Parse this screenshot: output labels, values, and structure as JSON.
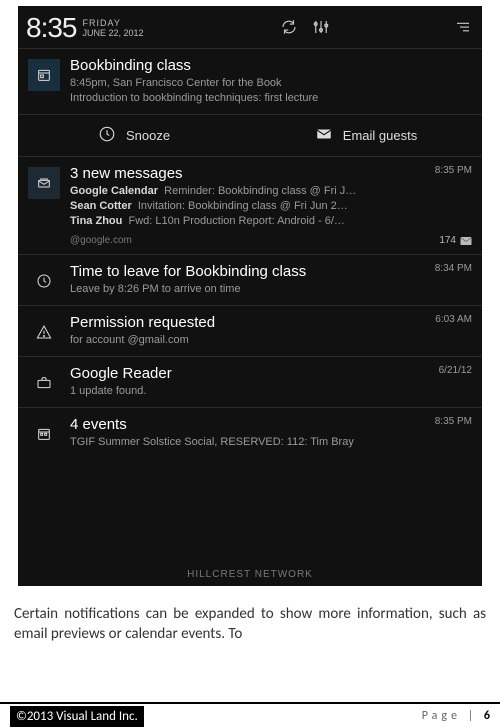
{
  "statusbar": {
    "time": "8:35",
    "day": "FRIDAY",
    "date": "JUNE 22, 2012"
  },
  "notifications": [
    {
      "icon": "calendar-day-icon",
      "title": "Bookbinding class",
      "sub1": "8:45pm, San Francisco Center for the Book",
      "sub2": "Introduction to bookbinding techniques: first lecture"
    },
    {
      "icon": "mail-stack-icon",
      "title": "3 new messages",
      "timestamp": "8:35 PM",
      "lines": [
        {
          "sender": "Google Calendar",
          "text": "Reminder: Bookbinding class @ Fri J…"
        },
        {
          "sender": "Sean Cotter",
          "text": "Invitation: Bookbinding class @ Fri Jun 2…"
        },
        {
          "sender": "Tina Zhou",
          "text": "Fwd: L10n Production Report: Android - 6/…"
        }
      ],
      "account": "@google.com",
      "count": "174"
    },
    {
      "icon": "clock-icon",
      "title": "Time to leave for Bookbinding class",
      "sub1": "Leave by 8:26 PM to arrive on time",
      "timestamp": "8:34 PM"
    },
    {
      "icon": "warning-icon",
      "title": "Permission requested",
      "sub1": "for account @gmail.com",
      "timestamp": "6:03 AM"
    },
    {
      "icon": "briefcase-icon",
      "title": "Google Reader",
      "sub1": "1 update found.",
      "timestamp": "6/21/12"
    },
    {
      "icon": "calendar-multi-icon",
      "title": "4 events",
      "sub1": "TGIF Summer Solstice Social, RESERVED: 112: Tim Bray",
      "timestamp": "8:35 PM"
    }
  ],
  "actions": {
    "snooze": "Snooze",
    "email_guests": "Email guests"
  },
  "carrier": "HILLCREST NETWORK",
  "doc": {
    "paragraph": "Certain notifications can be expanded to show more information, such as email previews or calendar events. To"
  },
  "footer": {
    "copyright": "©2013 Visual Land Inc.",
    "page_label": "Page",
    "page_number": "6"
  }
}
